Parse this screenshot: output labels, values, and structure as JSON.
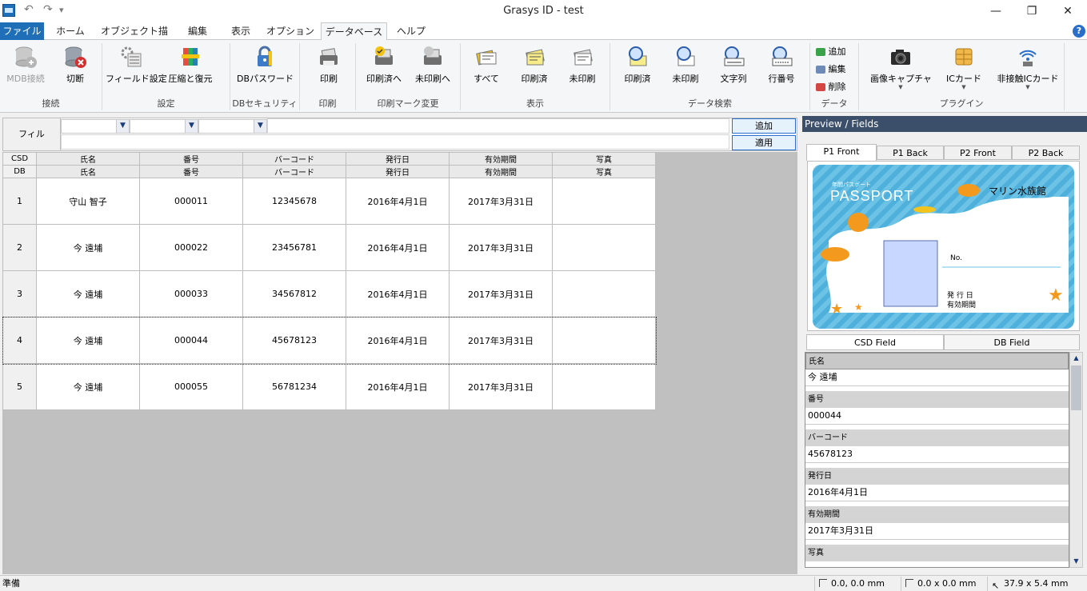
{
  "window": {
    "title": "Grasys ID - test",
    "minimize": "—",
    "maximize": "❐",
    "close": "✕"
  },
  "quick_access": {
    "undo": "↶",
    "redo": "↷",
    "more": "▾"
  },
  "tabs": [
    "ファイル",
    "ホーム",
    "オブジェクト描画",
    "編集",
    "表示",
    "オプション",
    "データベース",
    "ヘルプ"
  ],
  "active_tab": "データベース",
  "help": "?",
  "ribbon": {
    "buttons": [
      "MDB接続",
      "切断",
      "フィールド設定",
      "圧縮と復元",
      "DBパスワード",
      "印刷",
      "印刷済へ",
      "未印刷へ",
      "すべて",
      "印刷済",
      "未印刷",
      "印刷済",
      "未印刷",
      "文字列",
      "行番号",
      "追加",
      "編集",
      "削除",
      "画像キャプチャ",
      "ICカード",
      "非接触ICカード"
    ],
    "groups": [
      "接続",
      "設定",
      "DBセキュリティ",
      "印刷",
      "印刷マーク変更",
      "表示",
      "データ検索",
      "データ",
      "プラグイン"
    ]
  },
  "filter": {
    "label": "フィル",
    "add_button": "追加",
    "apply_button": "適用",
    "dropdown_arrow": "▼"
  },
  "grid": {
    "csd_label": "CSD",
    "db_label": "DB",
    "columns": [
      "氏名",
      "番号",
      "バーコード",
      "発行日",
      "有効期間",
      "写真"
    ],
    "rows": [
      {
        "n": "1",
        "name": "守山 智子",
        "number": "000011",
        "barcode": "12345678",
        "issued": "2016年4月1日",
        "valid": "2017年3月31日",
        "photo": ""
      },
      {
        "n": "2",
        "name": "今 遠埔",
        "number": "000022",
        "barcode": "23456781",
        "issued": "2016年4月1日",
        "valid": "2017年3月31日",
        "photo": ""
      },
      {
        "n": "3",
        "name": "今 遠埔",
        "number": "000033",
        "barcode": "34567812",
        "issued": "2016年4月1日",
        "valid": "2017年3月31日",
        "photo": ""
      },
      {
        "n": "4",
        "name": "今 遠埔",
        "number": "000044",
        "barcode": "45678123",
        "issued": "2016年4月1日",
        "valid": "2017年3月31日",
        "photo": ""
      },
      {
        "n": "5",
        "name": "今 遠埔",
        "number": "000055",
        "barcode": "56781234",
        "issued": "2016年4月1日",
        "valid": "2017年3月31日",
        "photo": ""
      }
    ]
  },
  "preview": {
    "header": "Preview / Fields",
    "page_tabs": [
      "P1 Front",
      "P1 Back",
      "P2 Front",
      "P2 Back"
    ],
    "active_page_tab": "P1 Front",
    "card": {
      "small_title": "年間パスポート",
      "title": "PASSPORT",
      "venue": "マリン水族館",
      "no_label": "No.",
      "issued_label": "発 行 日",
      "valid_label": "有効期間"
    },
    "field_tabs": [
      "CSD Field",
      "DB Field"
    ],
    "fields": [
      {
        "label": "氏名",
        "value": "今 遠埔"
      },
      {
        "label": "番号",
        "value": "000044"
      },
      {
        "label": "バーコード",
        "value": "45678123"
      },
      {
        "label": "発行日",
        "value": "2016年4月1日"
      },
      {
        "label": "有効期間",
        "value": "2017年3月31日"
      },
      {
        "label": "写真",
        "value": ""
      }
    ],
    "scroll_up": "▲",
    "scroll_down": "▼"
  },
  "status": {
    "text": "準備",
    "position": "0.0, 0.0 mm",
    "size": "0.0 x 0.0 mm",
    "cursor": "37.9 x 5.4 mm"
  },
  "colors": {
    "file_tab": "#1e6fb8",
    "panel_header": "#3b4f6a",
    "card_bg": "#6cc3e6",
    "fish": "#f39a1e"
  }
}
